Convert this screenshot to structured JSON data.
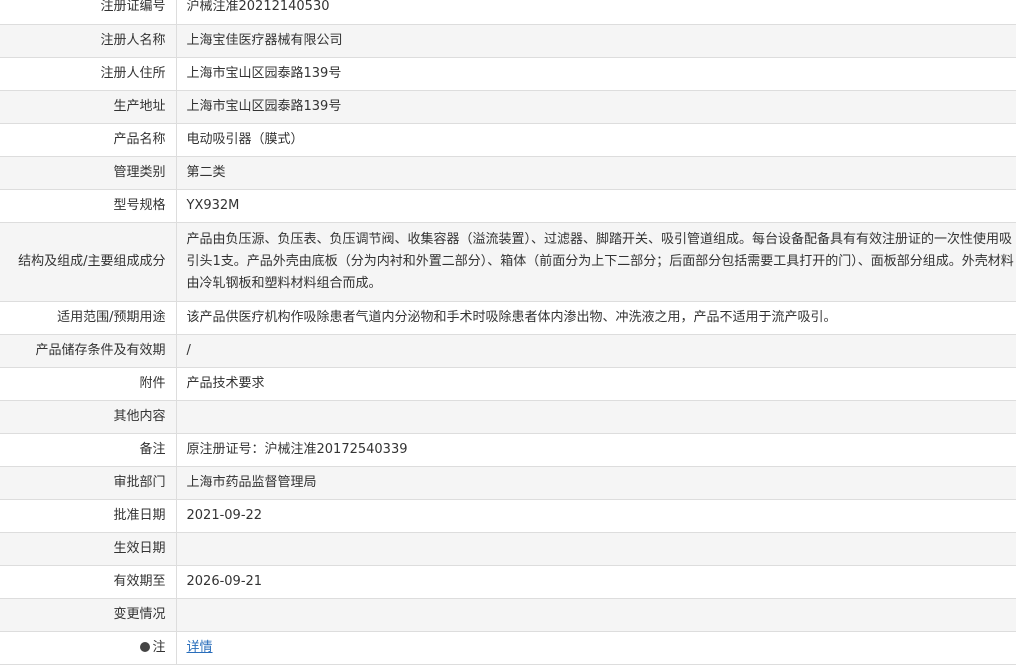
{
  "rows": [
    {
      "label": "注册证编号",
      "value": "沪械注准20212140530"
    },
    {
      "label": "注册人名称",
      "value": "上海宝佳医疗器械有限公司"
    },
    {
      "label": "注册人住所",
      "value": "上海市宝山区园泰路139号"
    },
    {
      "label": "生产地址",
      "value": "上海市宝山区园泰路139号"
    },
    {
      "label": "产品名称",
      "value": "电动吸引器（膜式）"
    },
    {
      "label": "管理类别",
      "value": "第二类"
    },
    {
      "label": "型号规格",
      "value": "YX932M"
    },
    {
      "label": "结构及组成/主要组成成分",
      "value": "产品由负压源、负压表、负压调节阀、收集容器（溢流装置）、过滤器、脚踏开关、吸引管道组成。每台设备配备具有有效注册证的一次性使用吸引头1支。产品外壳由底板（分为内衬和外置二部分）、箱体（前面分为上下二部分；后面部分包括需要工具打开的门）、面板部分组成。外壳材料由冷轧钢板和塑料材料组合而成。"
    },
    {
      "label": "适用范围/预期用途",
      "value": "该产品供医疗机构作吸除患者气道内分泌物和手术时吸除患者体内渗出物、冲洗液之用，产品不适用于流产吸引。"
    },
    {
      "label": "产品储存条件及有效期",
      "value": "/"
    },
    {
      "label": "附件",
      "value": "产品技术要求"
    },
    {
      "label": "其他内容",
      "value": ""
    },
    {
      "label": "备注",
      "value": "原注册证号：沪械注准20172540339"
    },
    {
      "label": "审批部门",
      "value": "上海市药品监督管理局"
    },
    {
      "label": "批准日期",
      "value": "2021-09-22"
    },
    {
      "label": "生效日期",
      "value": ""
    },
    {
      "label": "有效期至",
      "value": "2026-09-21"
    },
    {
      "label": "变更情况",
      "value": ""
    },
    {
      "label": "注",
      "value": "详情"
    }
  ]
}
